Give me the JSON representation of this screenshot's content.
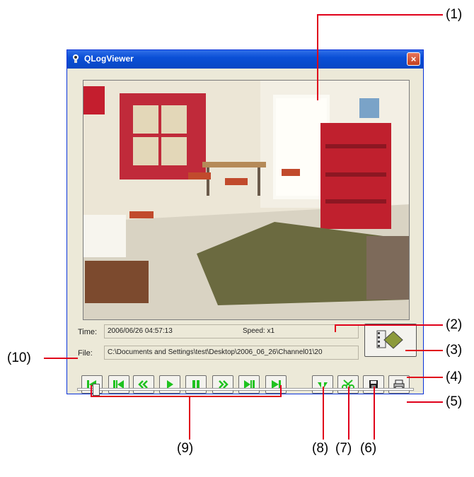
{
  "window": {
    "title": "QLogViewer",
    "close_glyph": "×"
  },
  "info": {
    "time_label": "Time:",
    "time_value": "2006/06/26 04:57:13",
    "speed_label": "Speed: x1",
    "file_label": "File:",
    "file_value": "C:\\Documents and Settings\\test\\Desktop\\2006_06_26\\Channel01\\20"
  },
  "icons": {
    "window": "camera-icon",
    "big_action": "film-diamond-icon",
    "playback": [
      "skip-to-start-icon",
      "previous-frame-icon",
      "rewind-icon",
      "play-icon",
      "pause-icon",
      "fast-forward-icon",
      "next-frame-icon",
      "skip-to-end-icon"
    ],
    "tools": [
      "mark-icon",
      "cut-icon",
      "save-icon",
      "print-icon"
    ]
  },
  "colors": {
    "accent_green": "#1fc21f",
    "callout_red": "#e0001a",
    "title_blue": "#0a4fd6"
  },
  "callouts": [
    "(1)",
    "(2)",
    "(3)",
    "(4)",
    "(5)",
    "(6)",
    "(7)",
    "(8)",
    "(9)",
    "(10)"
  ]
}
